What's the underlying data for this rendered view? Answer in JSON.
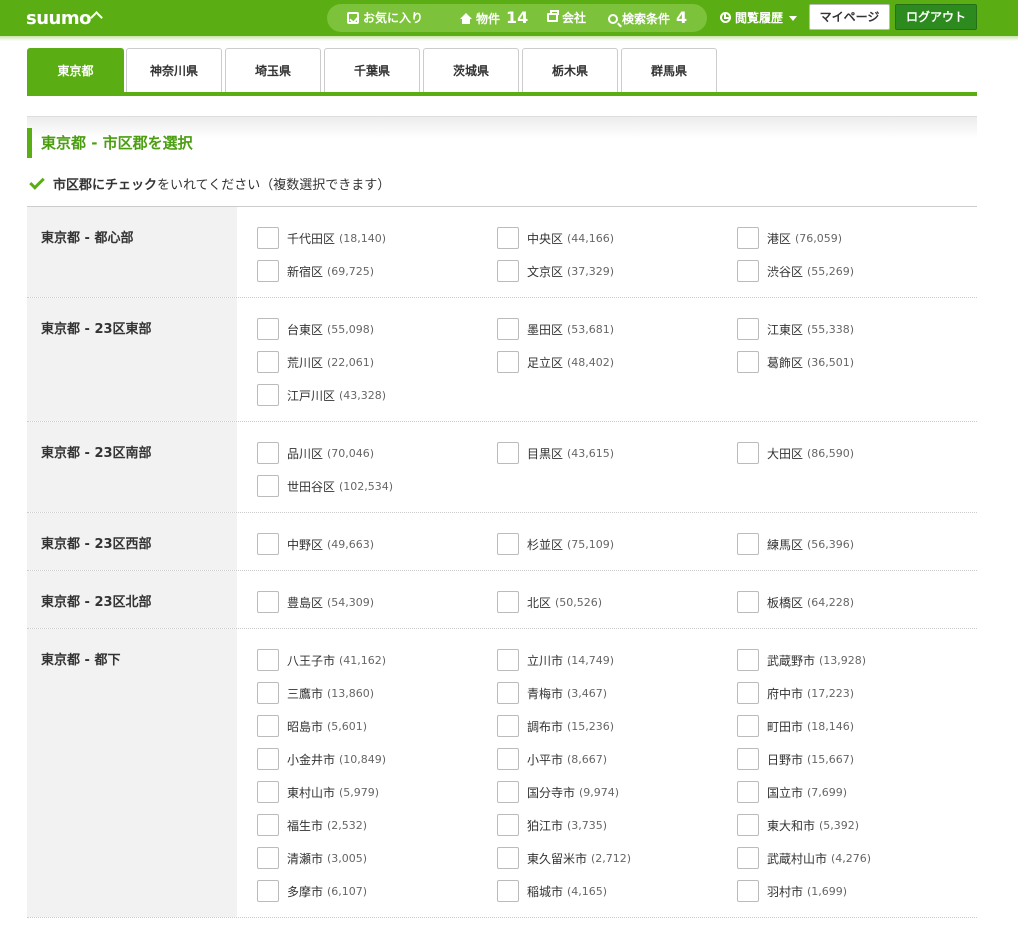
{
  "header": {
    "logo": "suumo",
    "favorites_label": "お気に入り",
    "properties_label": "物件",
    "properties_count": "14",
    "company_label": "会社",
    "search_conditions_label": "検索条件",
    "search_conditions_count": "4",
    "history_label": "閲覧履歴",
    "mypage_label": "マイページ",
    "logout_label": "ログアウト"
  },
  "tabs": [
    {
      "label": "東京都",
      "active": true
    },
    {
      "label": "神奈川県",
      "active": false
    },
    {
      "label": "埼玉県",
      "active": false
    },
    {
      "label": "千葉県",
      "active": false
    },
    {
      "label": "茨城県",
      "active": false
    },
    {
      "label": "栃木県",
      "active": false
    },
    {
      "label": "群馬県",
      "active": false
    }
  ],
  "section_title": "東京都 - 市区郡を選択",
  "instruction": {
    "bold": "市区郡にチェック",
    "rest": "をいれてください（複数選択できます）"
  },
  "regions": [
    {
      "label": "東京都 - 都心部",
      "cities": [
        {
          "name": "千代田区",
          "count": "(18,140)"
        },
        {
          "name": "中央区",
          "count": "(44,166)"
        },
        {
          "name": "港区",
          "count": "(76,059)"
        },
        {
          "name": "新宿区",
          "count": "(69,725)"
        },
        {
          "name": "文京区",
          "count": "(37,329)"
        },
        {
          "name": "渋谷区",
          "count": "(55,269)"
        }
      ]
    },
    {
      "label": "東京都 - 23区東部",
      "cities": [
        {
          "name": "台東区",
          "count": "(55,098)"
        },
        {
          "name": "墨田区",
          "count": "(53,681)"
        },
        {
          "name": "江東区",
          "count": "(55,338)"
        },
        {
          "name": "荒川区",
          "count": "(22,061)"
        },
        {
          "name": "足立区",
          "count": "(48,402)"
        },
        {
          "name": "葛飾区",
          "count": "(36,501)"
        },
        {
          "name": "江戸川区",
          "count": "(43,328)"
        }
      ]
    },
    {
      "label": "東京都 - 23区南部",
      "cities": [
        {
          "name": "品川区",
          "count": "(70,046)"
        },
        {
          "name": "目黒区",
          "count": "(43,615)"
        },
        {
          "name": "大田区",
          "count": "(86,590)"
        },
        {
          "name": "世田谷区",
          "count": "(102,534)"
        }
      ]
    },
    {
      "label": "東京都 - 23区西部",
      "cities": [
        {
          "name": "中野区",
          "count": "(49,663)"
        },
        {
          "name": "杉並区",
          "count": "(75,109)"
        },
        {
          "name": "練馬区",
          "count": "(56,396)"
        }
      ]
    },
    {
      "label": "東京都 - 23区北部",
      "cities": [
        {
          "name": "豊島区",
          "count": "(54,309)"
        },
        {
          "name": "北区",
          "count": "(50,526)"
        },
        {
          "name": "板橋区",
          "count": "(64,228)"
        }
      ]
    },
    {
      "label": "東京都 - 都下",
      "cities": [
        {
          "name": "八王子市",
          "count": "(41,162)"
        },
        {
          "name": "立川市",
          "count": "(14,749)"
        },
        {
          "name": "武蔵野市",
          "count": "(13,928)"
        },
        {
          "name": "三鷹市",
          "count": "(13,860)"
        },
        {
          "name": "青梅市",
          "count": "(3,467)"
        },
        {
          "name": "府中市",
          "count": "(17,223)"
        },
        {
          "name": "昭島市",
          "count": "(5,601)"
        },
        {
          "name": "調布市",
          "count": "(15,236)"
        },
        {
          "name": "町田市",
          "count": "(18,146)"
        },
        {
          "name": "小金井市",
          "count": "(10,849)"
        },
        {
          "name": "小平市",
          "count": "(8,667)"
        },
        {
          "name": "日野市",
          "count": "(15,667)"
        },
        {
          "name": "東村山市",
          "count": "(5,979)"
        },
        {
          "name": "国分寺市",
          "count": "(9,974)"
        },
        {
          "name": "国立市",
          "count": "(7,699)"
        },
        {
          "name": "福生市",
          "count": "(2,532)"
        },
        {
          "name": "狛江市",
          "count": "(3,735)"
        },
        {
          "name": "東大和市",
          "count": "(5,392)"
        },
        {
          "name": "清瀬市",
          "count": "(3,005)"
        },
        {
          "name": "東久留米市",
          "count": "(2,712)"
        },
        {
          "name": "武蔵村山市",
          "count": "(4,276)"
        },
        {
          "name": "多摩市",
          "count": "(6,107)"
        },
        {
          "name": "稲城市",
          "count": "(4,165)"
        },
        {
          "name": "羽村市",
          "count": "(1,699)"
        }
      ]
    }
  ]
}
